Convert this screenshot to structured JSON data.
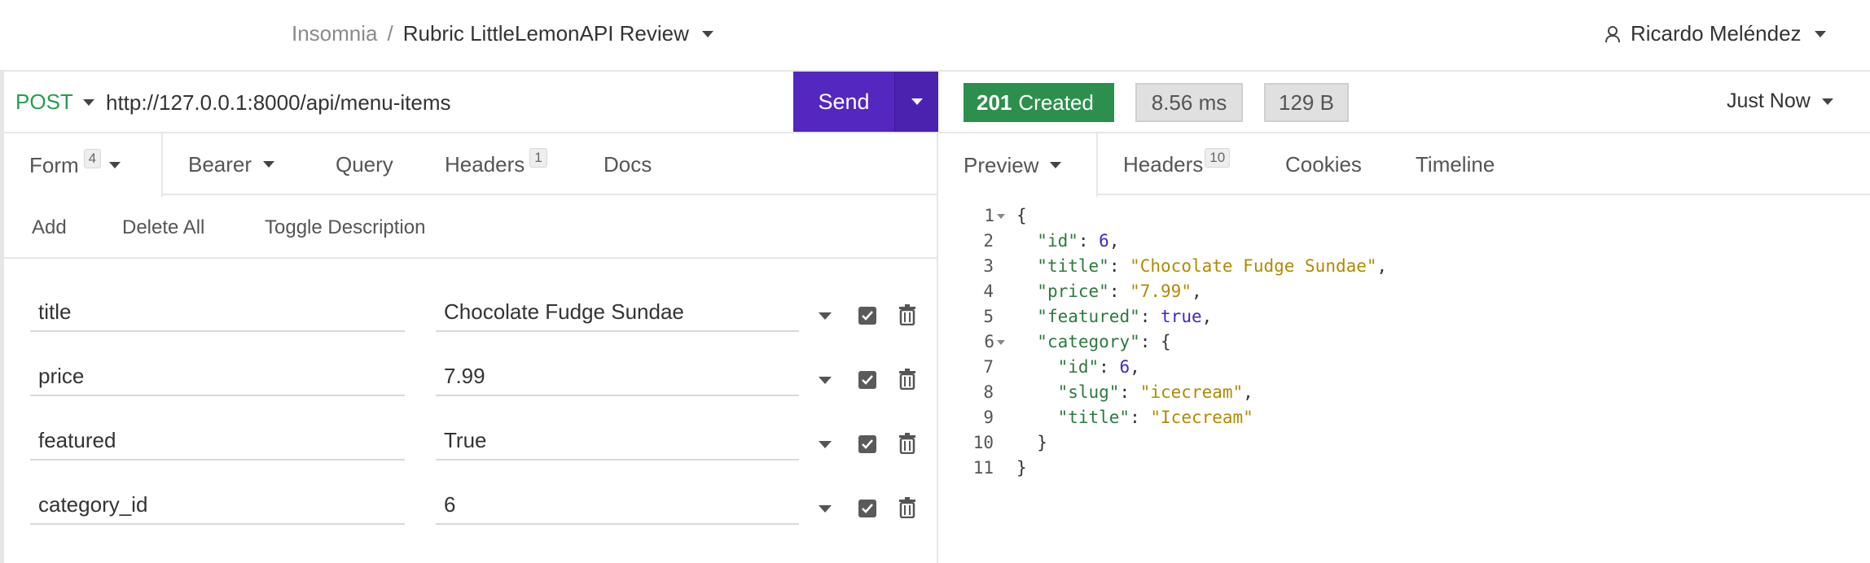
{
  "header": {
    "app_name": "Insomnia",
    "separator": "/",
    "workspace": "Rubric LittleLemonAPI Review",
    "user_name": "Ricardo Meléndez"
  },
  "request": {
    "method": "POST",
    "url": "http://127.0.0.1:8000/api/menu-items",
    "send_label": "Send",
    "tabs": [
      {
        "label": "Form",
        "badge": "4"
      },
      {
        "label": "Bearer"
      },
      {
        "label": "Query"
      },
      {
        "label": "Headers",
        "badge": "1"
      },
      {
        "label": "Docs"
      }
    ],
    "toolbar": {
      "add": "Add",
      "delete_all": "Delete All",
      "toggle_description": "Toggle Description"
    },
    "params": [
      {
        "name": "title",
        "value": "Chocolate Fudge Sundae"
      },
      {
        "name": "price",
        "value": "7.99"
      },
      {
        "name": "featured",
        "value": "True"
      },
      {
        "name": "category_id",
        "value": "6"
      }
    ]
  },
  "response": {
    "status_code": "201",
    "status_text": "Created",
    "time": "8.56 ms",
    "size": "129 B",
    "when": "Just Now",
    "tabs": [
      {
        "label": "Preview"
      },
      {
        "label": "Headers",
        "badge": "10"
      },
      {
        "label": "Cookies"
      },
      {
        "label": "Timeline"
      }
    ],
    "line_numbers": [
      "1",
      "2",
      "3",
      "4",
      "5",
      "6",
      "7",
      "8",
      "9",
      "10",
      "11"
    ],
    "body": {
      "open_brace": "{",
      "id_key": "\"id\"",
      "id_val": "6",
      "title_key": "\"title\"",
      "title_val": "\"Chocolate Fudge Sundae\"",
      "price_key": "\"price\"",
      "price_val": "\"7.99\"",
      "featured_key": "\"featured\"",
      "featured_val": "true",
      "category_key": "\"category\"",
      "cat_id_key": "\"id\"",
      "cat_id_val": "6",
      "slug_key": "\"slug\"",
      "slug_val": "\"icecream\"",
      "cat_title_key": "\"title\"",
      "cat_title_val": "\"Icecream\"",
      "inner_close": "}",
      "close_brace": "}"
    }
  },
  "colors": {
    "accent": "#5427c1",
    "status_success": "#2d8f4e",
    "method_post": "#2a9d4f"
  }
}
